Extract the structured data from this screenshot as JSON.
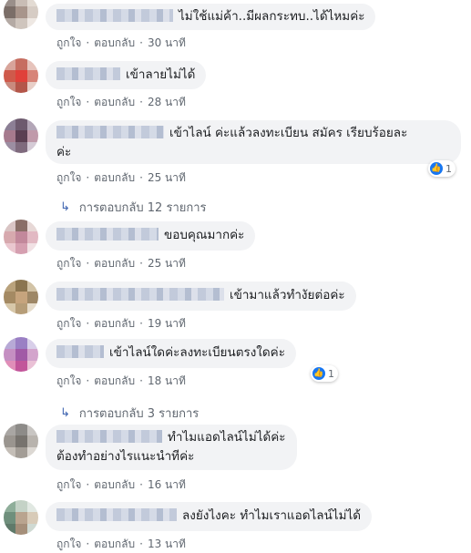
{
  "action_labels": {
    "like": "ถูกใจ",
    "reply": "ตอบกลับ"
  },
  "comments": [
    {
      "text": "ไม่ใช้แม่ค้า..มีผลกระทบ..ได้ไหมค่ะ",
      "time": "30 นาที"
    },
    {
      "text": "เข้าลายไม่ได้",
      "time": "28 นาที"
    },
    {
      "text_line1": "เข้าไลน์ ค่ะแล้วลงทะเบียน สมัคร เรียบร้อยละ",
      "text_line2": "ค่ะ",
      "time": "25 นาที",
      "likes": "1"
    },
    {
      "text": "ขอบคุณมากค่ะ",
      "time": "25 นาที"
    },
    {
      "text": "เข้ามาแล้วทำงัยต่อค่ะ",
      "time": "19 นาที"
    },
    {
      "text": "เข้าไลน์ใดค่ะลงทะเบียนตรงใดค่ะ",
      "time": "18 นาที",
      "likes": "1"
    },
    {
      "text_line1": "ทำไมแอดไลน์ไม่ได้ค่ะ",
      "text_line2": "ต้องทำอย่างไรแนะนำทีค่ะ",
      "time": "16 นาที"
    },
    {
      "text": "ลงยังไงคะ ทำไมเราแอดไลน์ไม่ได้",
      "time": "13 นาที"
    }
  ],
  "reply_links": [
    {
      "label": "การตอบกลับ 12 รายการ"
    },
    {
      "label": "การตอบกลับ 3 รายการ"
    }
  ],
  "icons": {
    "like": "thumbs-up-icon",
    "reply_arrow": "reply-arrow-icon"
  },
  "colors": {
    "bubble": "#f2f3f5",
    "meta": "#606770",
    "like_badge": "#1877f2",
    "reply_arrow": "#4267b2"
  }
}
